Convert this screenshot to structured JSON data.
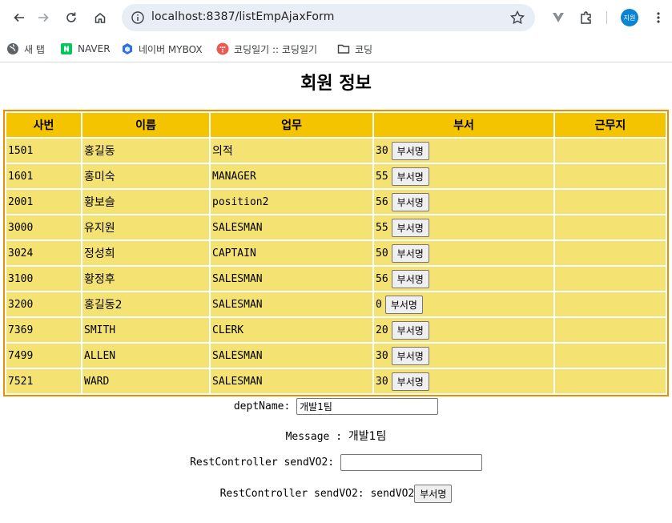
{
  "browser": {
    "url": "localhost:8387/listEmpAjaxForm",
    "avatar_text": "지원",
    "bookmarks": [
      {
        "label": "새 탭",
        "icon": "globe-icon"
      },
      {
        "label": "NAVER",
        "icon": "naver-icon"
      },
      {
        "label": "네이버 MYBOX",
        "icon": "mybox-icon"
      },
      {
        "label": "코딩일기 :: 코딩일기",
        "icon": "tistory-icon"
      },
      {
        "label": "코딩",
        "icon": "folder-icon"
      }
    ]
  },
  "page": {
    "title": "회원 정보",
    "table": {
      "headers": [
        "사번",
        "이름",
        "업무",
        "부서",
        "근무지"
      ],
      "dept_button_label": "부서명",
      "rows": [
        {
          "empno": "1501",
          "name": "홍길동",
          "job": "의적",
          "deptno": "30",
          "loc": ""
        },
        {
          "empno": "1601",
          "name": "홍미숙",
          "job": "MANAGER",
          "deptno": "55",
          "loc": ""
        },
        {
          "empno": "2001",
          "name": "황보슬",
          "job": "position2",
          "deptno": "56",
          "loc": ""
        },
        {
          "empno": "3000",
          "name": "유지원",
          "job": "SALESMAN",
          "deptno": "55",
          "loc": ""
        },
        {
          "empno": "3024",
          "name": "정성희",
          "job": "CAPTAIN",
          "deptno": "50",
          "loc": ""
        },
        {
          "empno": "3100",
          "name": "황정후",
          "job": "SALESMAN",
          "deptno": "56",
          "loc": ""
        },
        {
          "empno": "3200",
          "name": "홍길동2",
          "job": "SALESMAN",
          "deptno": "0",
          "loc": ""
        },
        {
          "empno": "7369",
          "name": "SMITH",
          "job": "CLERK",
          "deptno": "20",
          "loc": ""
        },
        {
          "empno": "7499",
          "name": "ALLEN",
          "job": "SALESMAN",
          "deptno": "30",
          "loc": ""
        },
        {
          "empno": "7521",
          "name": "WARD",
          "job": "SALESMAN",
          "deptno": "30",
          "loc": ""
        }
      ]
    },
    "dept_name": {
      "label": "deptName:",
      "value": "개발1팀"
    },
    "message": {
      "label": "Message :",
      "value": "개발1팀"
    },
    "sendvo2_input": {
      "label": "RestController sendVO2:",
      "value": ""
    },
    "sendvo2_result": {
      "label": "RestController sendVO2: sendVO2",
      "button_label": "부서명"
    }
  },
  "colors": {
    "header_bg": "#f5c400",
    "cell_bg": "#f4e273",
    "table_border": "#f08c00"
  }
}
